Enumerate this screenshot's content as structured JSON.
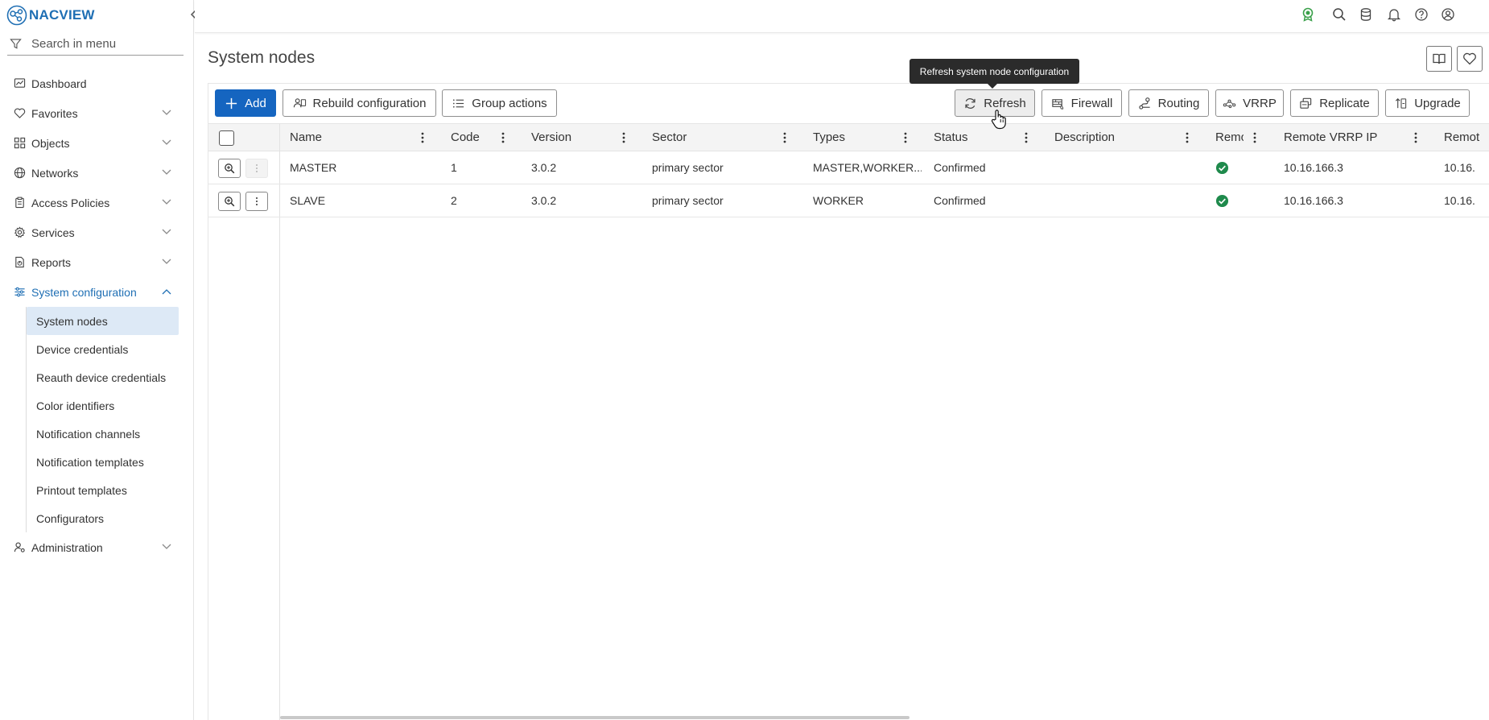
{
  "app": {
    "logo_text": "NACVIEW"
  },
  "menu_search": {
    "placeholder": "Search in menu"
  },
  "nav": {
    "items": [
      {
        "label": "Dashboard"
      },
      {
        "label": "Favorites"
      },
      {
        "label": "Objects"
      },
      {
        "label": "Networks"
      },
      {
        "label": "Access Policies"
      },
      {
        "label": "Services"
      },
      {
        "label": "Reports"
      },
      {
        "label": "System configuration"
      }
    ],
    "sub_items": [
      {
        "label": "System nodes"
      },
      {
        "label": "Device credentials"
      },
      {
        "label": "Reauth device credentials"
      },
      {
        "label": "Color identifiers"
      },
      {
        "label": "Notification channels"
      },
      {
        "label": "Notification templates"
      },
      {
        "label": "Printout templates"
      },
      {
        "label": "Configurators"
      }
    ],
    "after": [
      {
        "label": "Administration"
      }
    ]
  },
  "page": {
    "title": "System nodes"
  },
  "toolbar": {
    "add": "Add",
    "rebuild": "Rebuild configuration",
    "group_actions": "Group actions",
    "refresh": "Refresh",
    "firewall": "Firewall",
    "routing": "Routing",
    "vrrp": "VRRP",
    "replicate": "Replicate",
    "upgrade": "Upgrade"
  },
  "tooltip": {
    "text": "Refresh system node configuration"
  },
  "table": {
    "columns": [
      "Name",
      "Code",
      "Version",
      "Sector",
      "Types",
      "Status",
      "Description",
      "Remo",
      "Remote VRRP IP",
      "Remot"
    ],
    "rows": [
      {
        "name": "MASTER",
        "code": "1",
        "version": "3.0.2",
        "sector": "primary sector",
        "types": "MASTER,WORKER...",
        "status": "Confirmed",
        "description": "",
        "remote_vrrp_ip": "10.16.166.3",
        "remote_next": "10.16."
      },
      {
        "name": "SLAVE",
        "code": "2",
        "version": "3.0.2",
        "sector": "primary sector",
        "types": "WORKER",
        "status": "Confirmed",
        "description": "",
        "remote_vrrp_ip": "10.16.166.3",
        "remote_next": "10.16."
      }
    ]
  },
  "colors": {
    "accent": "#1f6fb4",
    "primary_button": "#1565c0",
    "selected_bg": "#dde9f6",
    "ok_green": "#1f8a4c",
    "license_green": "#3aa04a"
  }
}
